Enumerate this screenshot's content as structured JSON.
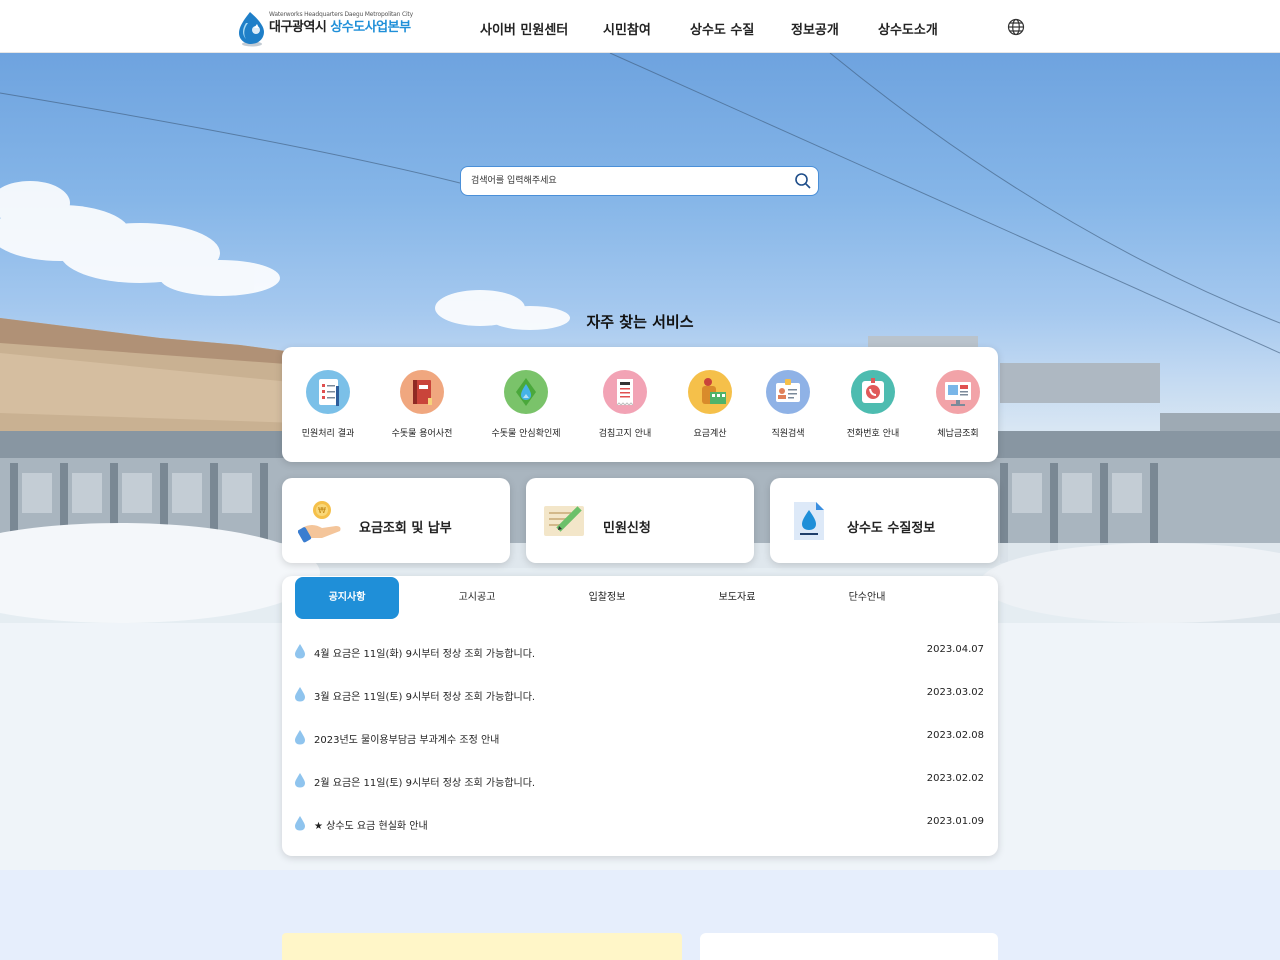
{
  "logo": {
    "sub": "Waterworks Headquarters Daegu Metropolitan City",
    "main_part1": "대구광역시",
    "main_part2": "상수도사업본부"
  },
  "nav": {
    "items": [
      "사이버 민원센터",
      "시민참여",
      "상수도 수질",
      "정보공개",
      "상수도소개"
    ],
    "globe_icon": "globe-icon"
  },
  "search": {
    "placeholder": "검색어를 입력해주세요",
    "icon": "search-icon"
  },
  "quick_services": {
    "title": "자주 찾는 서비스",
    "items": [
      {
        "label": "민원처리 결과",
        "icon": "checklist-icon"
      },
      {
        "label": "수돗물 용어사전",
        "icon": "book-icon"
      },
      {
        "label": "수돗물 안심확인제",
        "icon": "water-leaf-icon"
      },
      {
        "label": "검침고지 안내",
        "icon": "meter-bill-icon"
      },
      {
        "label": "요금계산",
        "icon": "calculator-icon"
      },
      {
        "label": "직원검색",
        "icon": "id-card-icon"
      },
      {
        "label": "전화번호 안내",
        "icon": "phone-icon"
      },
      {
        "label": "체납금조회",
        "icon": "arrears-icon"
      }
    ]
  },
  "big_cards": [
    {
      "label": "요금조회 및 납부",
      "icon": "coin-hand-icon"
    },
    {
      "label": "민원신청",
      "icon": "pencil-note-icon"
    },
    {
      "label": "상수도 수질정보",
      "icon": "water-document-icon"
    }
  ],
  "notice": {
    "tabs": [
      "공지사항",
      "고시공고",
      "입찰정보",
      "보도자료",
      "단수안내"
    ],
    "active_tab": "공지사항",
    "items": [
      {
        "title": "4월 요금은 11일(화) 9시부터 정상 조회 가능합니다.",
        "date": "2023.04.07"
      },
      {
        "title": "3월 요금은 11일(토) 9시부터 정상 조회 가능합니다.",
        "date": "2023.03.02"
      },
      {
        "title": "2023년도 물이용부담금 부과계수 조정 안내",
        "date": "2023.02.08"
      },
      {
        "title": "2월 요금은 11일(토) 9시부터 정상 조회 가능합니다.",
        "date": "2023.02.02"
      },
      {
        "title": "★ 상수도 요금 현실화 안내",
        "date": "2023.01.09"
      }
    ]
  },
  "colors": {
    "accent": "#1f8fd8",
    "bottom_bg": "#e6eefc",
    "banner_yellow": "#fff6c8"
  }
}
